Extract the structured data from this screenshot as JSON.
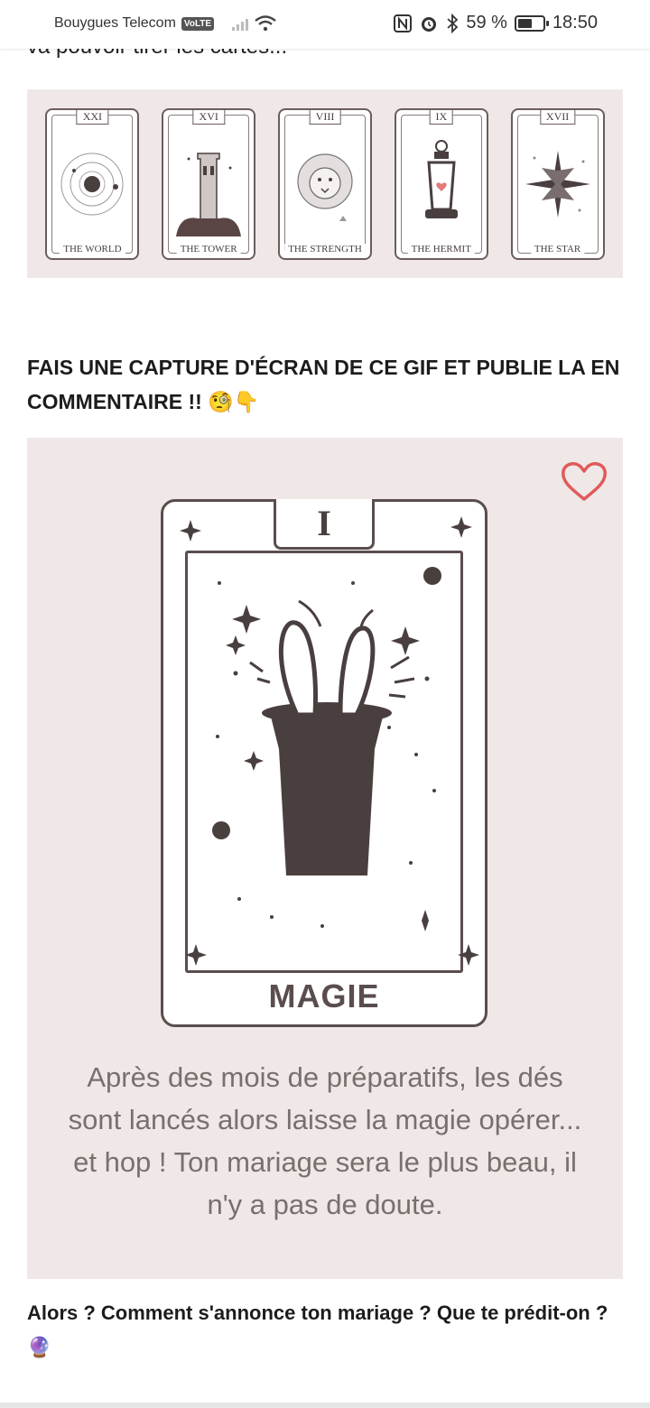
{
  "status_bar": {
    "carrier": "Bouygues Telecom",
    "volte": "VoLTE",
    "battery_percent": "59 %",
    "battery_level": 0.59,
    "time": "18:50"
  },
  "article": {
    "cut_text": "va pouvoir tirer les cartes...",
    "tarot_cards": [
      {
        "numeral": "XXI",
        "name": "THE WORLD",
        "icon": "world-icon"
      },
      {
        "numeral": "XVI",
        "name": "THE TOWER",
        "icon": "tower-icon"
      },
      {
        "numeral": "VIII",
        "name": "THE STRENGTH",
        "icon": "lion-icon"
      },
      {
        "numeral": "IX",
        "name": "THE HERMIT",
        "icon": "lantern-icon"
      },
      {
        "numeral": "XVII",
        "name": "THE STAR",
        "icon": "star-icon"
      }
    ],
    "heading": "FAIS UNE CAPTURE D'ÉCRAN DE CE GIF ET PUBLIE LA EN COMMENTAIRE !! 🧐👇",
    "gif": {
      "numeral": "I",
      "card_name": "MAGIE",
      "caption": "Après des mois de préparatifs, les dés sont lancés alors laisse la magie opérer... et hop ! Ton mariage sera le plus beau, il n'y a pas de doute.",
      "heart_icon": "heart-icon"
    },
    "footer": "Alors ? Comment s'annonce ton mariage ? Que te prédit-on ? 🔮"
  },
  "colors": {
    "card_background": "#efe8e6",
    "ink": "#5a4d4d",
    "heart": "#e05a5a"
  }
}
